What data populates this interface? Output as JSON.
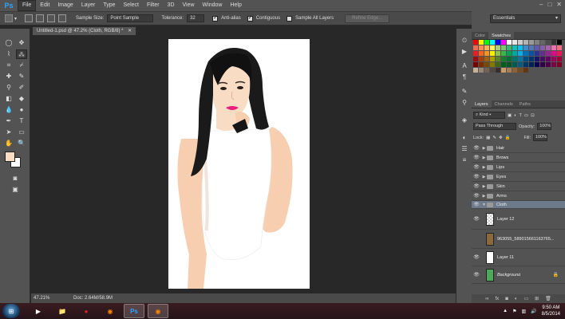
{
  "app": {
    "logo": "Ps"
  },
  "menus": [
    "File",
    "Edit",
    "Image",
    "Layer",
    "Type",
    "Select",
    "Filter",
    "3D",
    "View",
    "Window",
    "Help"
  ],
  "options": {
    "sample_size_label": "Sample Size:",
    "sample_size_value": "Point Sample",
    "tolerance_label": "Tolerance:",
    "tolerance_value": "32",
    "anti_alias": "Anti-alias",
    "contiguous": "Contiguous",
    "sample_all_layers": "Sample All Layers",
    "refine_edge": "Refine Edge..."
  },
  "workspace": "Essentials",
  "document": {
    "tab_title": "Untitled-1.psd @ 47.2% (Cloth, RGB/8) *",
    "zoom": "47.21%",
    "doc_info": "Doc: 2.64M/58.9M"
  },
  "panels": {
    "top_tabs": [
      "Color",
      "Swatches"
    ],
    "layer_tabs": [
      "Layers",
      "Channels",
      "Paths"
    ],
    "kind_label": "Kind",
    "blend_mode": "Pass Through",
    "opacity_label": "Opacity:",
    "opacity_value": "100%",
    "lock_label": "Lock:",
    "fill_label": "Fill:",
    "fill_value": "100%"
  },
  "layers": [
    {
      "name": "Hair",
      "type": "group"
    },
    {
      "name": "Brows",
      "type": "group"
    },
    {
      "name": "Lips",
      "type": "group"
    },
    {
      "name": "Eyes",
      "type": "group"
    },
    {
      "name": "Skin",
      "type": "group"
    },
    {
      "name": "Arms",
      "type": "group"
    },
    {
      "name": "Cloth",
      "type": "group-open"
    },
    {
      "name": "Layer 12",
      "type": "layer"
    },
    {
      "name": "963055_589015661163765...",
      "type": "photo"
    },
    {
      "name": "Layer 11",
      "type": "layer"
    },
    {
      "name": "Background",
      "type": "bg"
    }
  ],
  "taskbar": {
    "time": "9:50 AM",
    "date": "8/5/2014"
  },
  "colors": {
    "accent": "#2fa3ff",
    "selected_layer": "#6c7a8c",
    "foreground": "#f9dcc4",
    "background": "#ffffff"
  }
}
